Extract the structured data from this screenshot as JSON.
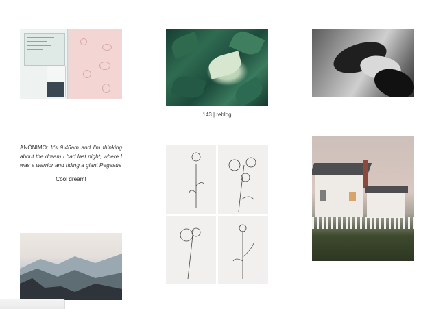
{
  "posts": {
    "leaves": {
      "notes": "143",
      "separator": " | ",
      "reblog": "reblog"
    },
    "text_post": {
      "asker": "ANÓNIMO:",
      "question": "It's 9:46am and I'm thinking about the dream I had last night, where I was a warrior and riding a giant Pegasus",
      "answer": "Cool dream!"
    }
  }
}
